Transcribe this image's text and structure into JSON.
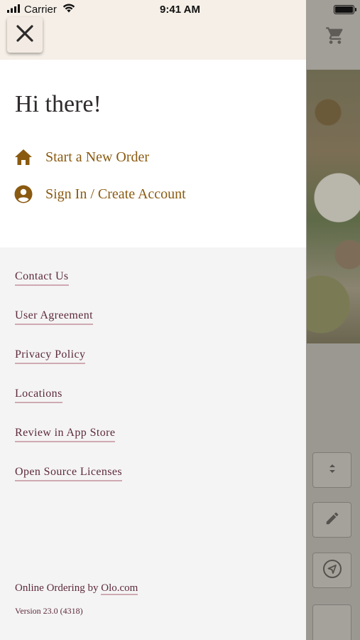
{
  "status_bar": {
    "carrier": "Carrier",
    "time": "9:41 AM",
    "icons": [
      "signal-icon",
      "wifi-icon",
      "battery-icon"
    ]
  },
  "background": {
    "icons": [
      "cart-icon",
      "sort-icon",
      "pencil-icon",
      "navigate-icon"
    ]
  },
  "drawer": {
    "close_icon": "close-icon",
    "greeting": "Hi there!",
    "menu": [
      {
        "label": "Start a New Order",
        "icon": "home-icon"
      },
      {
        "label": "Sign In / Create Account",
        "icon": "account-icon"
      }
    ],
    "links": [
      "Contact Us",
      "User Agreement",
      "Privacy Policy",
      "Locations",
      "Review in App Store",
      "Open Source Licenses"
    ],
    "footer": {
      "prefix": "Online Ordering by ",
      "link": "Olo.com",
      "version": "Version 23.0 (4318)"
    }
  },
  "colors": {
    "accent_gold": "#8a5a10",
    "link_maroon": "#5d2a3a",
    "link_underline": "#cfaab3",
    "drawer_header_bg": "#f5efe7",
    "drawer_bg": "#f4f4f4",
    "panel_bg": "#ffffff"
  }
}
